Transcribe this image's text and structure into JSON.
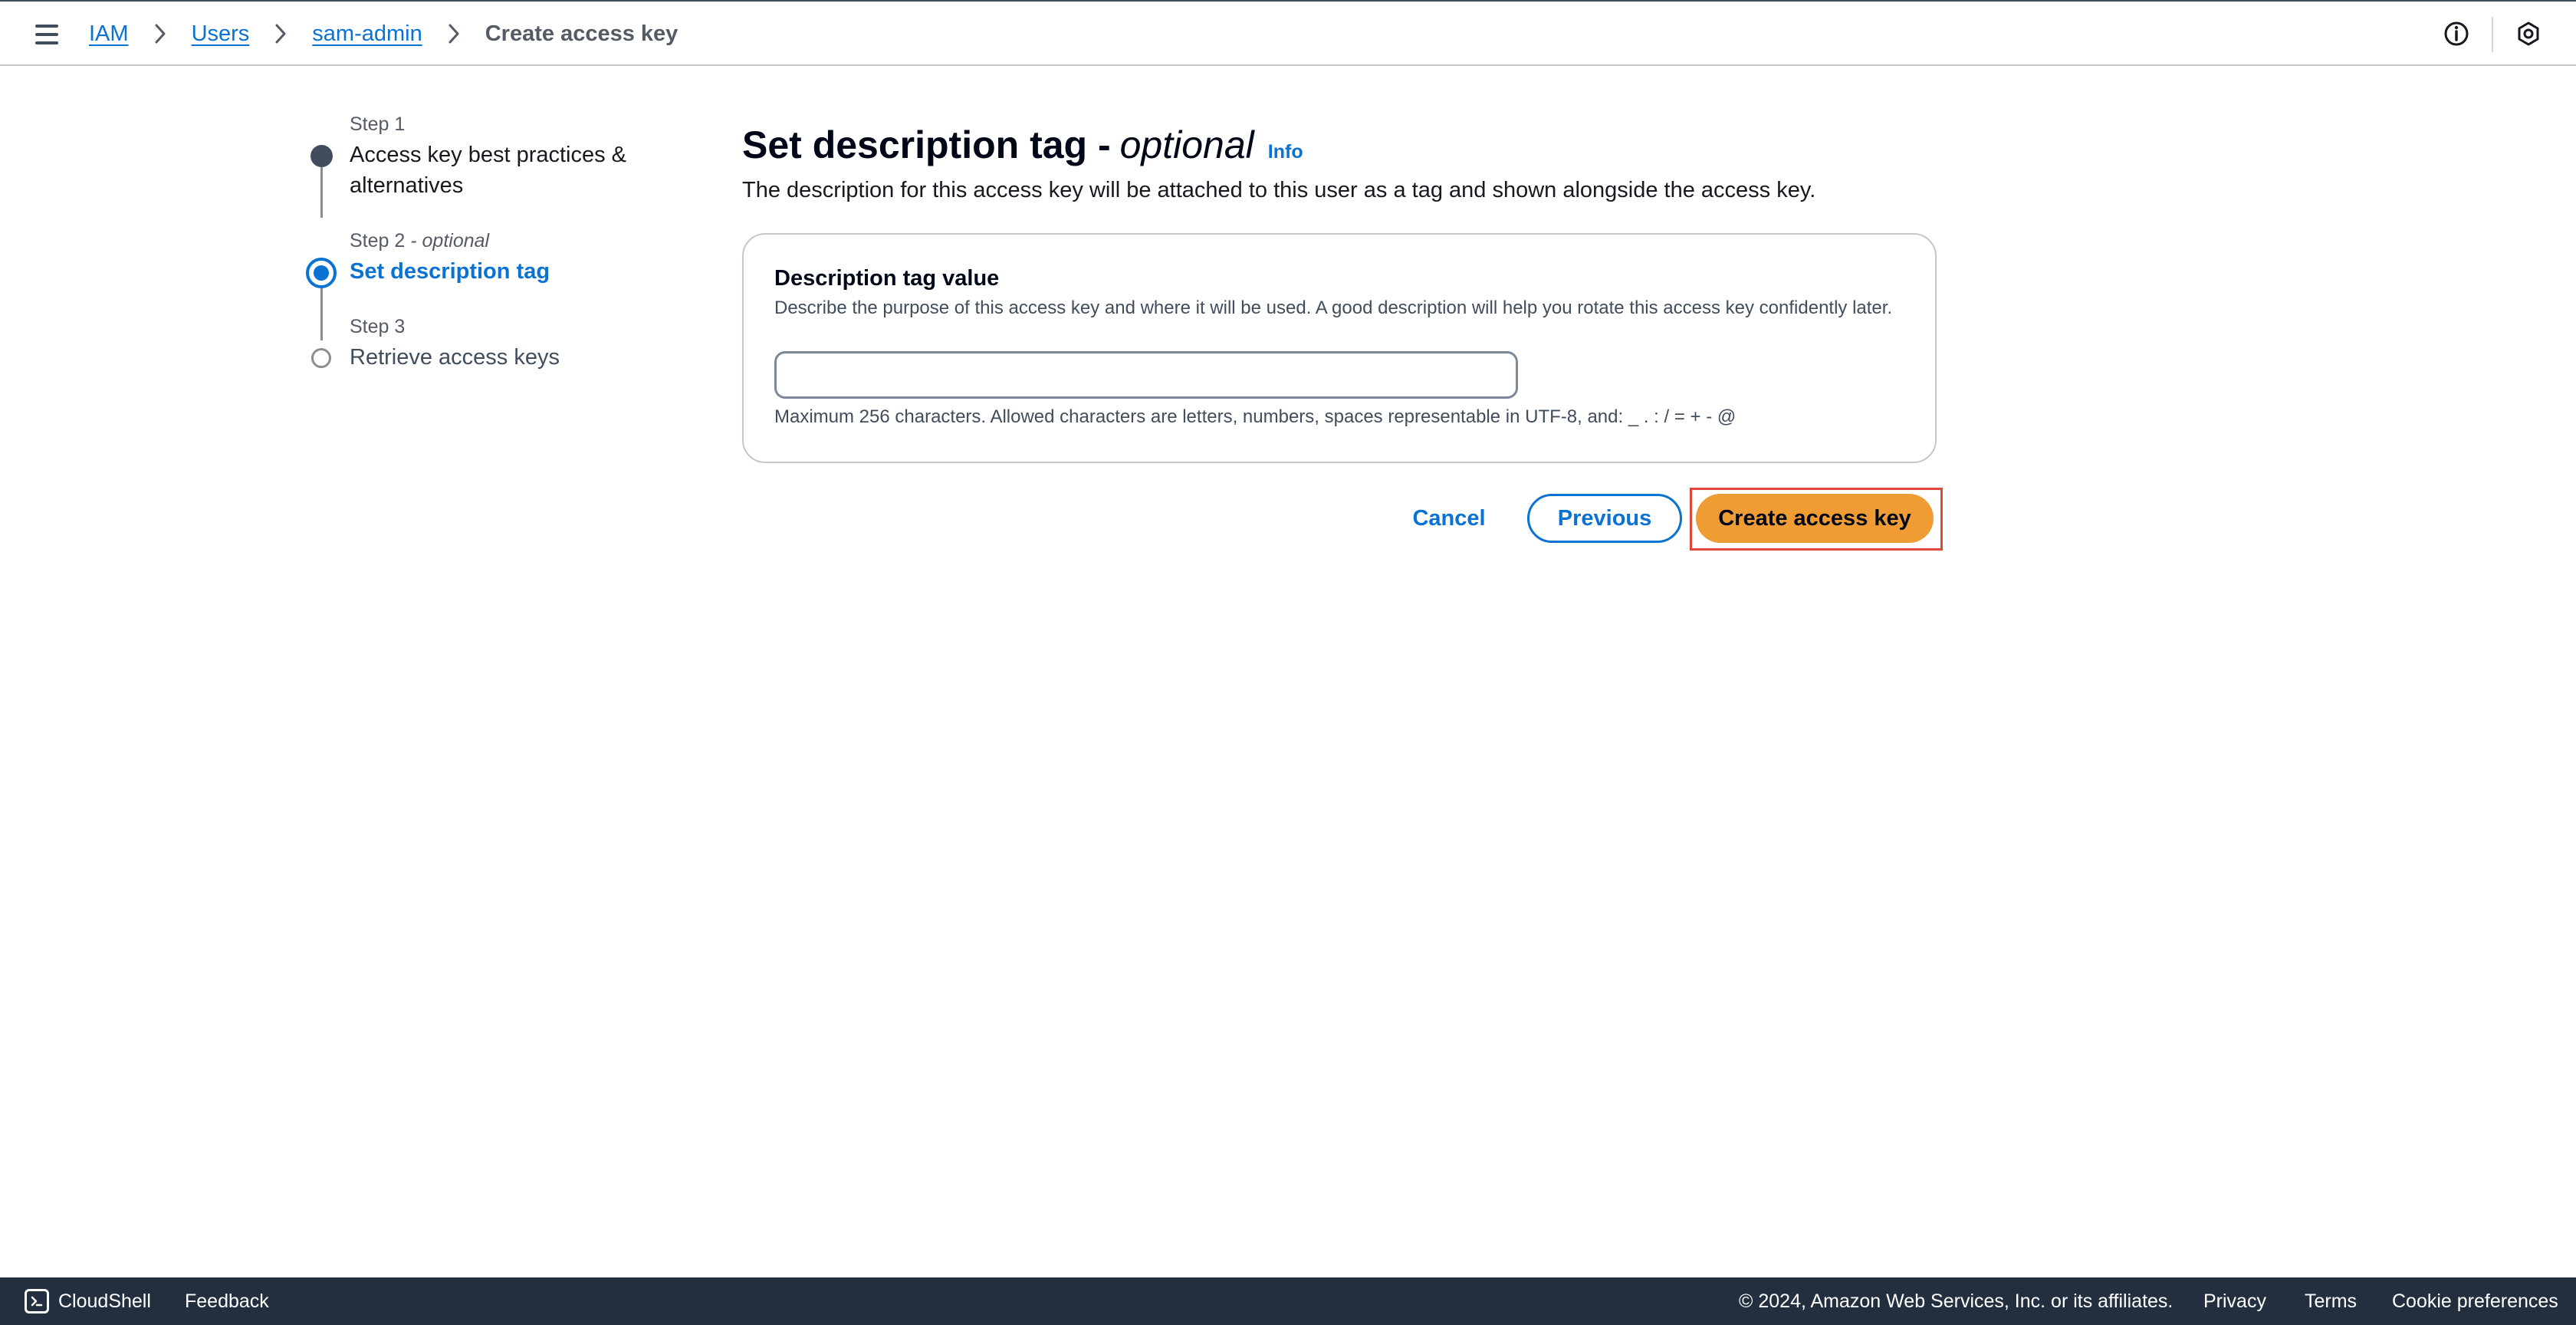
{
  "breadcrumb": {
    "items": [
      "IAM",
      "Users",
      "sam-admin"
    ],
    "current": "Create access key"
  },
  "steps": [
    {
      "label": "Step 1",
      "title": "Access key best practices & alternatives",
      "title_line1": "Access key best practices &",
      "title_line2": "alternatives",
      "state": "completed"
    },
    {
      "label": "Step 2",
      "label_suffix": "- optional",
      "title": "Set description tag",
      "state": "current"
    },
    {
      "label": "Step 3",
      "title": "Retrieve access keys",
      "state": "upcoming"
    }
  ],
  "page": {
    "title": "Set description tag -",
    "title_optional": "optional",
    "info_link": "Info",
    "description": "The description for this access key will be attached to this user as a tag and shown alongside the access key."
  },
  "form": {
    "field_label": "Description tag value",
    "field_description": "Describe the purpose of this access key and where it will be used. A good description will help you rotate this access key confidently later.",
    "field_value": "",
    "constraint": "Maximum 256 characters. Allowed characters are letters, numbers, spaces representable in UTF-8, and: _ . : / = + - @"
  },
  "actions": {
    "cancel": "Cancel",
    "previous": "Previous",
    "create": "Create access key"
  },
  "footer": {
    "cloudshell": "CloudShell",
    "feedback": "Feedback",
    "copyright": "© 2024, Amazon Web Services, Inc. or its affiliates.",
    "privacy": "Privacy",
    "terms": "Terms",
    "cookies": "Cookie preferences"
  },
  "colors": {
    "link": "#0972d3",
    "primary_button": "#f09c35",
    "footer_bg": "#232f3e",
    "highlight": "#e0493a"
  },
  "icons": [
    "menu-icon",
    "chevron-right-icon",
    "info-icon",
    "settings-icon",
    "cloudshell-icon"
  ]
}
